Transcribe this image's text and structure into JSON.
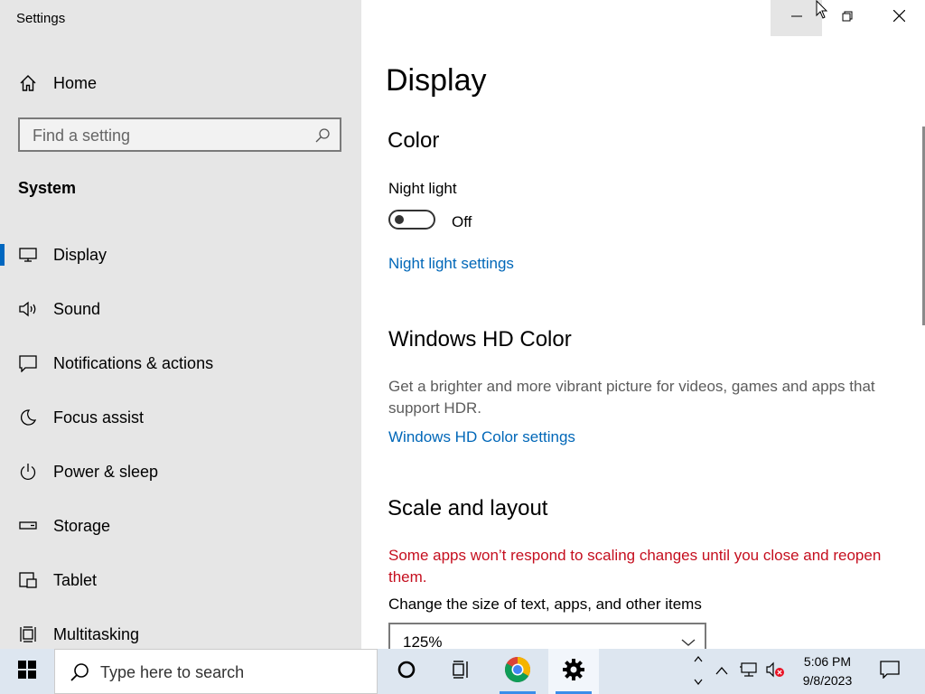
{
  "window": {
    "title": "Settings"
  },
  "sidebar": {
    "home_label": "Home",
    "search_placeholder": "Find a setting",
    "section": "System",
    "items": [
      {
        "label": "Display",
        "icon": "monitor-icon",
        "active": true
      },
      {
        "label": "Sound",
        "icon": "speaker-icon"
      },
      {
        "label": "Notifications & actions",
        "icon": "notification-icon"
      },
      {
        "label": "Focus assist",
        "icon": "moon-icon"
      },
      {
        "label": "Power & sleep",
        "icon": "power-icon"
      },
      {
        "label": "Storage",
        "icon": "storage-icon"
      },
      {
        "label": "Tablet",
        "icon": "tablet-icon"
      },
      {
        "label": "Multitasking",
        "icon": "multitasking-icon"
      }
    ]
  },
  "main": {
    "title": "Display",
    "color_section": {
      "heading": "Color",
      "night_light_label": "Night light",
      "night_light_state": "Off",
      "night_light_link": "Night light settings"
    },
    "hdr_section": {
      "heading": "Windows HD Color",
      "description": "Get a brighter and more vibrant picture for videos, games and apps that support HDR.",
      "link": "Windows HD Color settings"
    },
    "scale_section": {
      "heading": "Scale and layout",
      "warning": "Some apps won’t respond to scaling changes until you close and reopen them.",
      "change_size_label": "Change the size of text, apps, and other items",
      "scale_value": "125%"
    }
  },
  "taskbar": {
    "search_placeholder": "Type here to search",
    "clock_time": "5:06 PM",
    "clock_date": "9/8/2023"
  },
  "colors": {
    "accent": "#0067c0",
    "link": "#0067b8",
    "warning": "#c50f1f",
    "sidebar_bg": "#e6e6e6",
    "taskbar_bg": "#dde6f0"
  }
}
